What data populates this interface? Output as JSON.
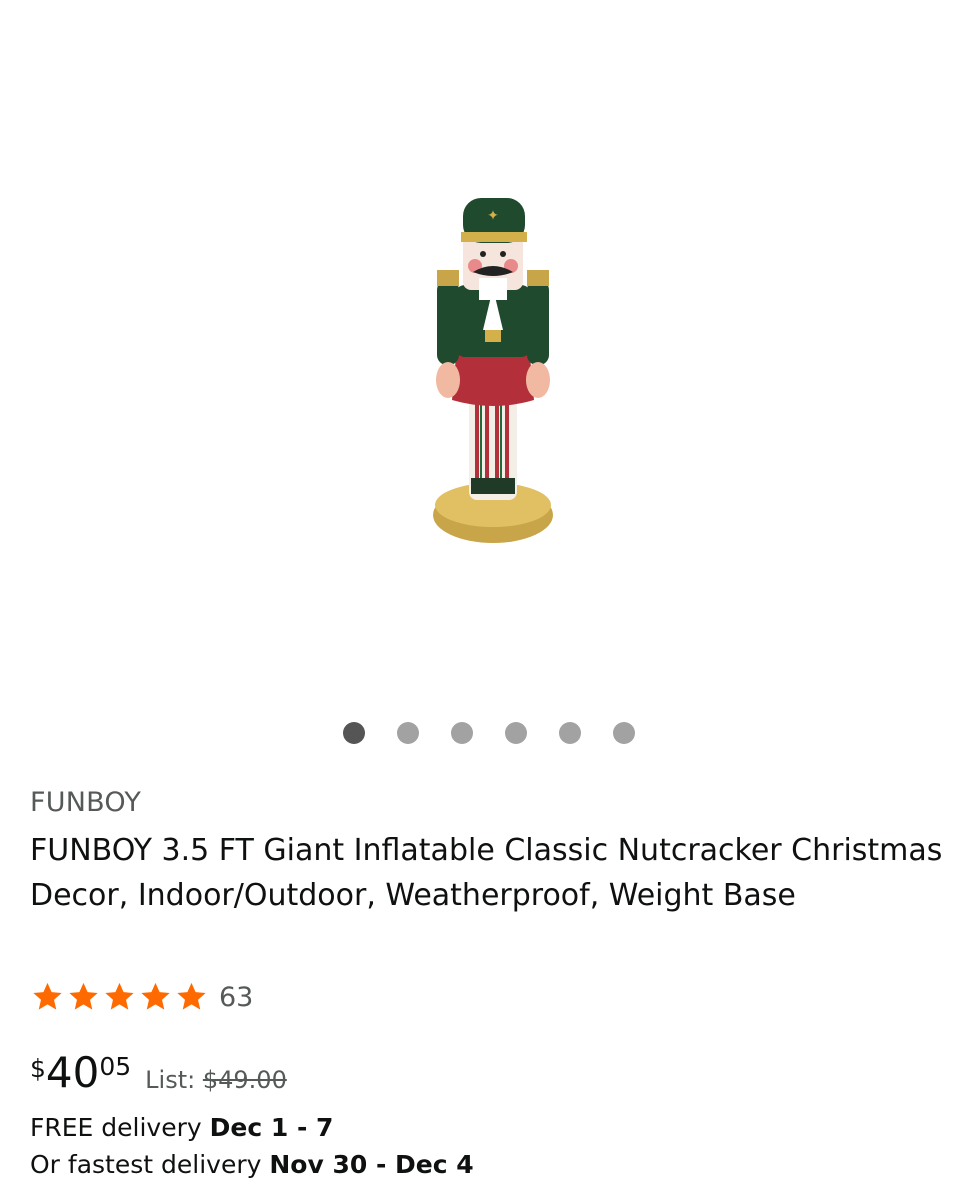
{
  "gallery": {
    "image_alt": "FUNBOY inflatable nutcracker",
    "image_count": 6,
    "active_index": 0
  },
  "product": {
    "brand": "FUNBOY",
    "title": "FUNBOY 3.5 FT Giant Inflatable Classic Nutcracker Christmas Decor, Indoor/Outdoor, Weatherproof, Weight Base",
    "rating": {
      "stars": 5,
      "count": "63",
      "star_color": "#ff6a00"
    },
    "price": {
      "symbol": "$",
      "whole": "40",
      "fraction": "05",
      "list_label": "List:",
      "list_price": "$49.00"
    },
    "delivery": {
      "free_label": "FREE delivery",
      "free_dates": "Dec 1 - 7",
      "fast_label": "Or fastest delivery",
      "fast_dates": "Nov 30 - Dec 4"
    }
  },
  "colors": {
    "uniform_green": "#1f4a2e",
    "gold": "#d4b04a",
    "red": "#b3303a",
    "dot_active": "#555555",
    "dot_inactive": "#a2a2a2"
  }
}
